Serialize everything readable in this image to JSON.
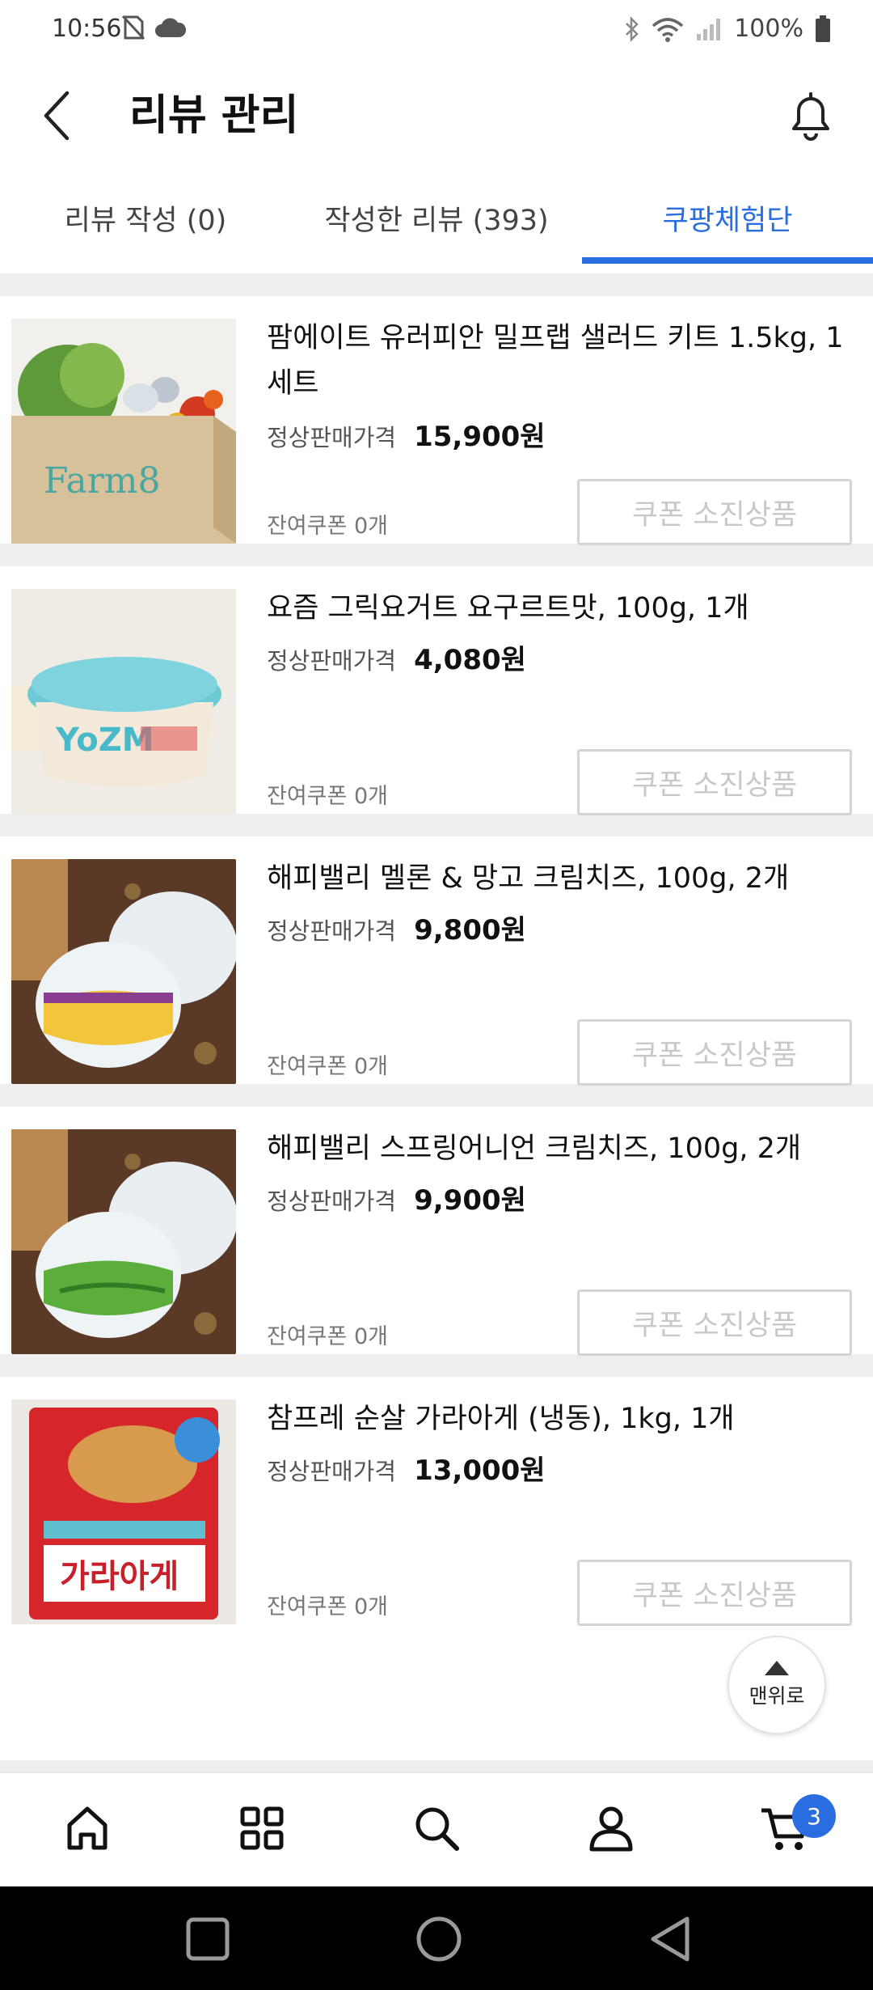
{
  "status_bar": {
    "time": "10:56",
    "battery": "100%"
  },
  "header": {
    "title": "리뷰 관리"
  },
  "tabs": [
    {
      "label": "리뷰 작성 (0)",
      "active": false
    },
    {
      "label": "작성한 리뷰 (393)",
      "active": false
    },
    {
      "label": "쿠팡체험단",
      "active": true
    }
  ],
  "common": {
    "price_label": "정상판매가격",
    "coupon_button": "쿠폰 소진상품"
  },
  "products": [
    {
      "name": "팜에이트 유러피안 밀프랩 샐러드 키트 1.5kg, 1세트",
      "price": "15,900원",
      "remaining": "잔여쿠폰 0개",
      "image": "salad-kit-box"
    },
    {
      "name": "요즘 그릭요거트 요구르트맛, 100g, 1개",
      "price": "4,080원",
      "remaining": "잔여쿠폰 0개",
      "image": "greek-yogurt-cup"
    },
    {
      "name": "해피밸리 멜론 & 망고 크림치즈, 100g, 2개",
      "price": "9,800원",
      "remaining": "잔여쿠폰 0개",
      "image": "melon-mango-cream-cheese"
    },
    {
      "name": "해피밸리 스프링어니언 크림치즈, 100g, 2개",
      "price": "9,900원",
      "remaining": "잔여쿠폰 0개",
      "image": "spring-onion-cream-cheese"
    },
    {
      "name": "참프레 순살 가라아게 (냉동), 1kg, 1개",
      "price": "13,000원",
      "remaining": "잔여쿠폰 0개",
      "image": "chicken-karaage-bag"
    }
  ],
  "scroll_top": {
    "label": "맨위로"
  },
  "bottom_nav": {
    "items": [
      "home-icon",
      "category-grid-icon",
      "search-icon",
      "user-icon",
      "cart-icon"
    ],
    "cart_badge": "3"
  },
  "colors": {
    "accent": "#2a6de1",
    "divider": "#eeeeee",
    "disabled_text": "#c8c8c8"
  }
}
